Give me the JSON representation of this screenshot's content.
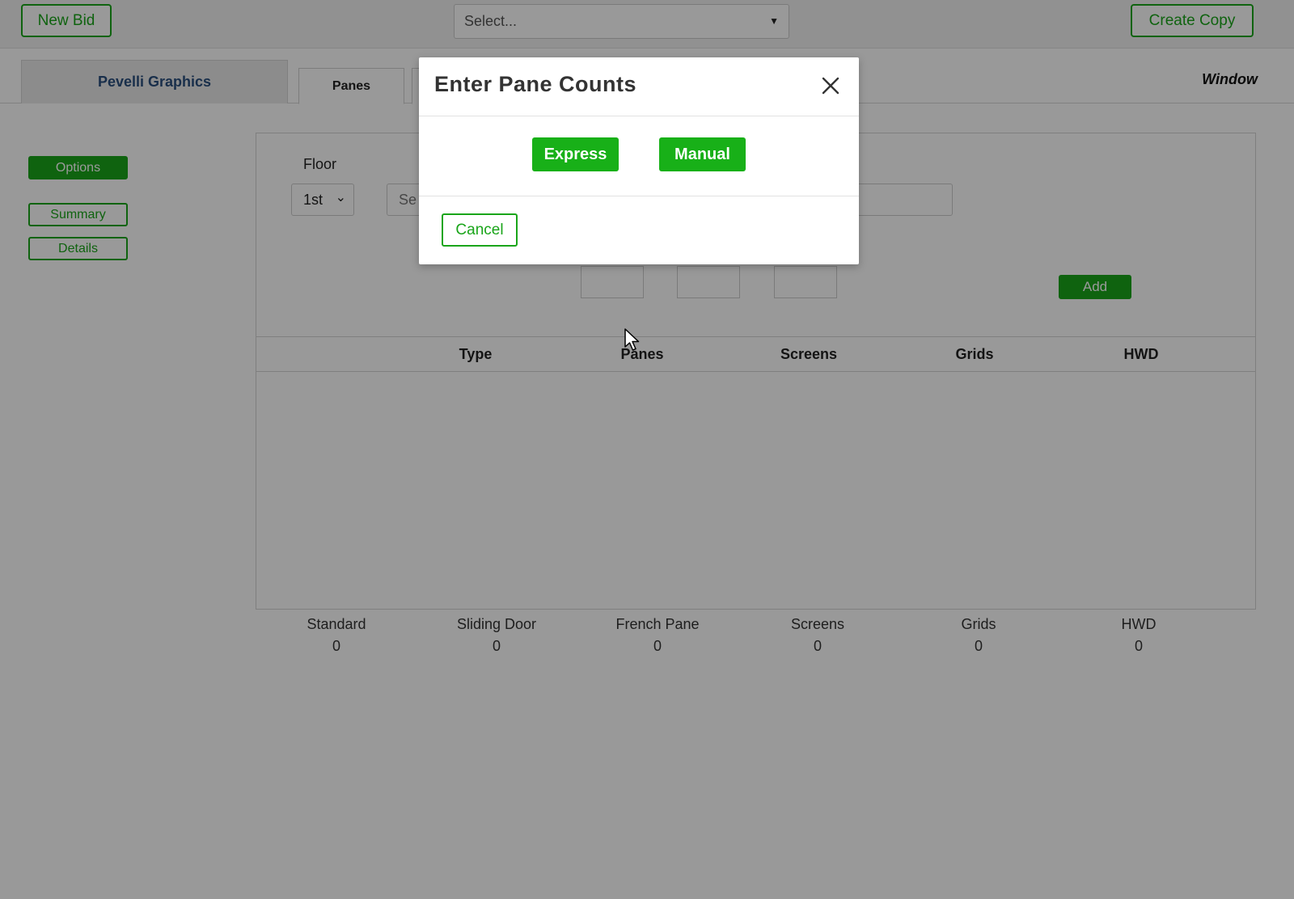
{
  "toolbar": {
    "new_bid_label": "New Bid",
    "bid_select_placeholder": "Select...",
    "create_copy_label": "Create Copy"
  },
  "tabs": {
    "company": "Pevelli Graphics",
    "items": [
      {
        "label": "Panes",
        "active": true
      },
      {
        "label": "",
        "active": false
      }
    ],
    "window_label": "Window"
  },
  "sidebar": {
    "items": [
      {
        "label": "Options",
        "active": true
      },
      {
        "label": "Summary",
        "active": false
      },
      {
        "label": "Details",
        "active": false
      }
    ]
  },
  "form": {
    "floor_label": "Floor",
    "floor_value": "1st",
    "type_placeholder": "Se",
    "add_label": "Add"
  },
  "table": {
    "columns": [
      "Type",
      "Panes",
      "Screens",
      "Grids",
      "HWD"
    ],
    "rows": []
  },
  "totals": [
    {
      "label": "Standard",
      "value": "0"
    },
    {
      "label": "Sliding Door",
      "value": "0"
    },
    {
      "label": "French Pane",
      "value": "0"
    },
    {
      "label": "Screens",
      "value": "0"
    },
    {
      "label": "Grids",
      "value": "0"
    },
    {
      "label": "HWD",
      "value": "0"
    }
  ],
  "modal": {
    "title": "Enter Pane Counts",
    "express_label": "Express",
    "manual_label": "Manual",
    "cancel_label": "Cancel"
  },
  "colors": {
    "accent_green": "#1aa51a",
    "brand_blue": "#2b4f7e",
    "overlay": "rgba(0,0,0,0.4)"
  },
  "icons": {
    "close": "close-icon",
    "select_caret": "caret-down-icon",
    "floor_chevron": "chevron-down-icon",
    "pointer": "mouse-pointer-icon"
  }
}
